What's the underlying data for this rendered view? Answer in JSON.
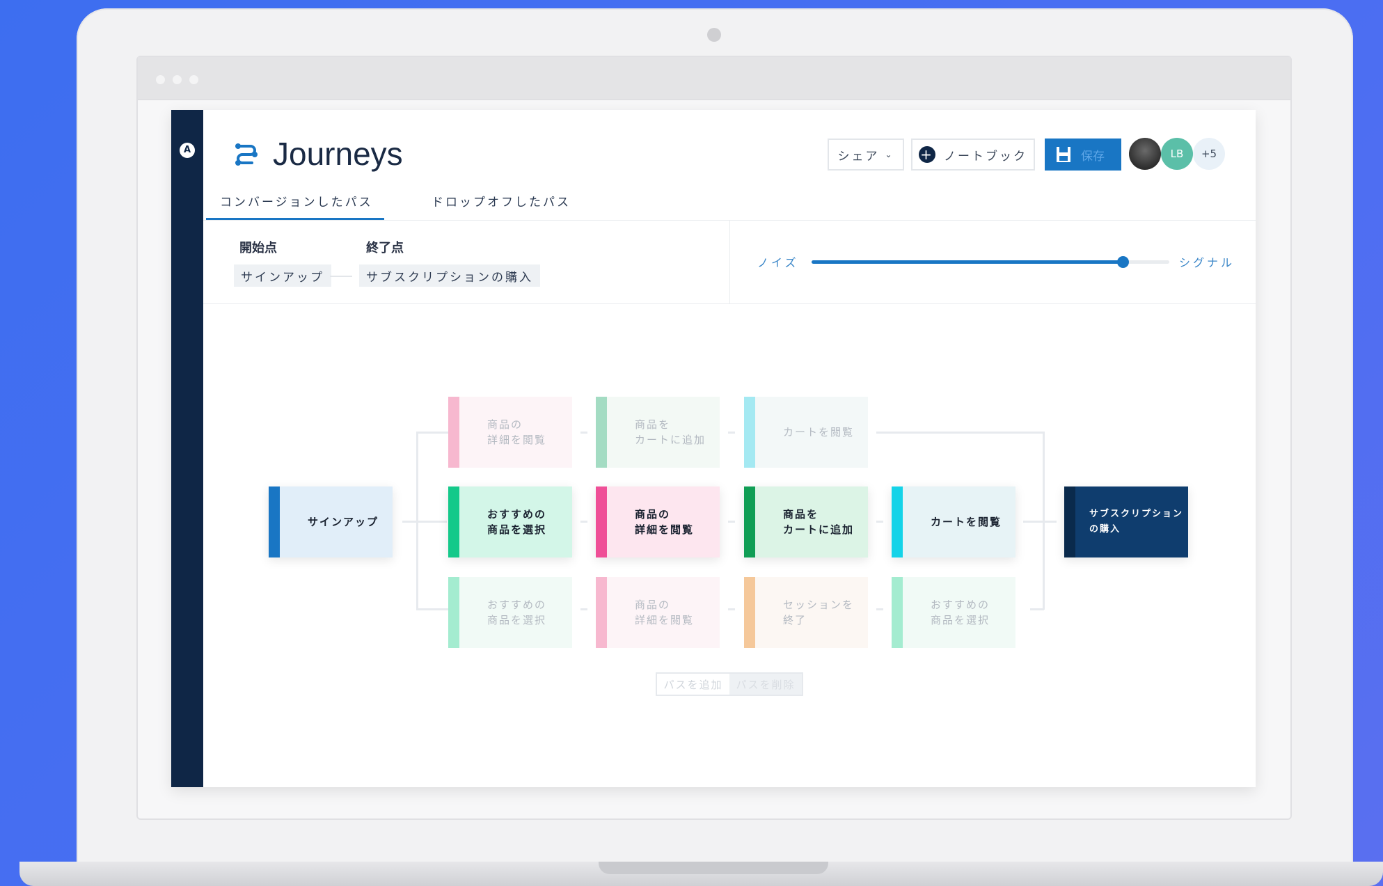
{
  "app": {
    "title": "Journeys",
    "tabs": [
      {
        "label": "コンバージョンしたパス",
        "active": true
      },
      {
        "label": "ドロップオフしたパス",
        "active": false
      }
    ],
    "buttons": {
      "share": "シェア",
      "notebook": "ノートブック",
      "save": "保存"
    },
    "avatars": [
      {
        "initials": "",
        "kind": "photo"
      },
      {
        "initials": "LB",
        "color": "#5bbfa8"
      },
      {
        "initials": "+5",
        "color": "#e9f1f8"
      }
    ]
  },
  "filters": {
    "start_label": "開始点",
    "end_label": "終了点",
    "start_value": "サインアップ",
    "end_value": "サブスクリプションの購入"
  },
  "slider": {
    "left_label": "ノイズ",
    "right_label": "シグナル",
    "value": 0.87
  },
  "flow": {
    "start": "サインアップ",
    "end": "サブスクリプション\nの購入",
    "top_row": [
      "商品の\n詳細を閲覧",
      "商品を\nカートに追加",
      "カートを閲覧"
    ],
    "middle_row": [
      "おすすめの\n商品を選択",
      "商品の\n詳細を閲覧",
      "商品を\nカートに追加",
      "カートを閲覧"
    ],
    "bottom_row": [
      "おすすめの\n商品を選択",
      "商品の\n詳細を閲覧",
      "セッションを\n終了",
      "おすすめの\n商品を選択"
    ],
    "actions": {
      "add_path": "パスを追加",
      "remove_path": "パスを削除"
    }
  },
  "colors": {
    "accent": "#1976c4",
    "sidebar": "#0f2646",
    "end_node": "#0f3d6e"
  }
}
